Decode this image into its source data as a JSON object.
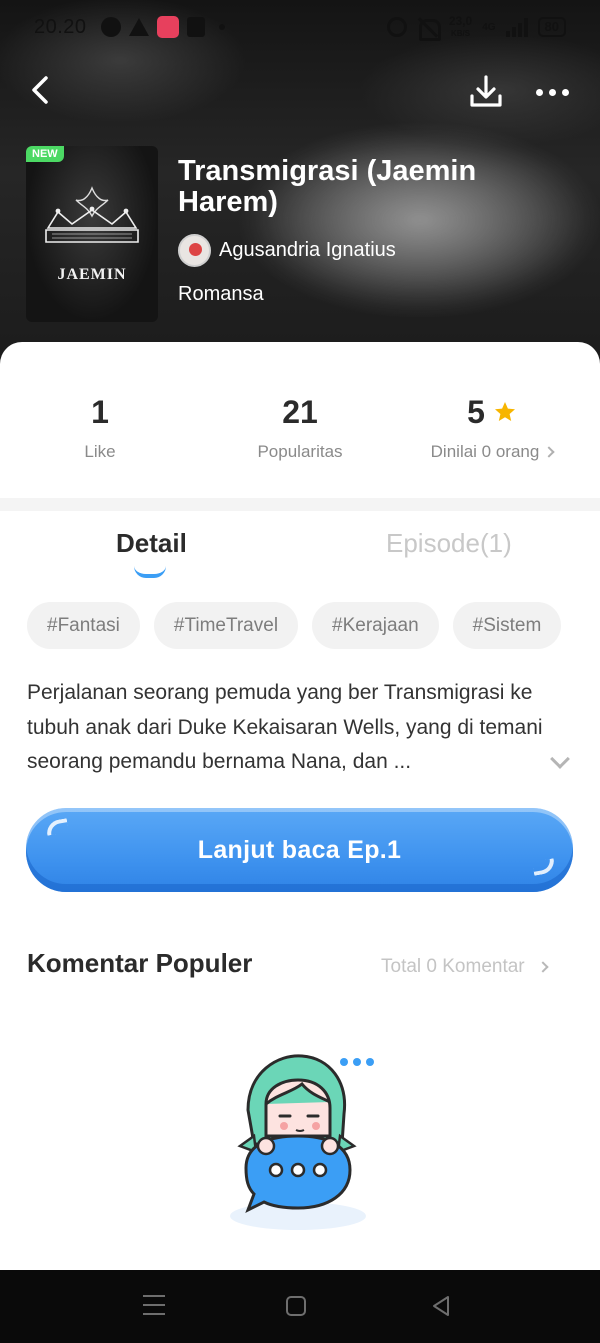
{
  "status_bar": {
    "time": "20.20",
    "network_speed": "23,0",
    "network_speed_unit": "KB/S",
    "network_type": "4G",
    "battery": "80"
  },
  "book": {
    "badge": "NEW",
    "cover_title": "JAEMIN",
    "title": "Transmigrasi (Jaemin Harem)",
    "author": "Agusandria Ignatius",
    "genre": "Romansa"
  },
  "stats": {
    "likes_value": "1",
    "likes_label": "Like",
    "popularity_value": "21",
    "popularity_label": "Popularitas",
    "rating_value": "5",
    "rating_label": "Dinilai 0 orang"
  },
  "tabs": {
    "detail": "Detail",
    "episode": "Episode(1)"
  },
  "tags": [
    "#Fantasi",
    "#TimeTravel",
    "#Kerajaan",
    "#Sistem"
  ],
  "synopsis": "Perjalanan seorang pemuda yang ber Transmigrasi ke tubuh anak dari Duke Kekaisaran Wells, yang di temani seorang pemandu bernama Nana, dan ...",
  "cta_label": "Lanjut baca Ep.1",
  "comments": {
    "title": "Komentar Populer",
    "total": "Total 0 Komentar"
  },
  "colors": {
    "accent": "#3f93ef",
    "star": "#f7b500",
    "new_badge": "#4cd964"
  },
  "icons": [
    "back-arrow-icon",
    "download-icon",
    "more-icon",
    "star-icon",
    "chevron-right-icon",
    "chevron-down-icon",
    "menu-icon",
    "home-icon",
    "back-triangle-icon"
  ]
}
